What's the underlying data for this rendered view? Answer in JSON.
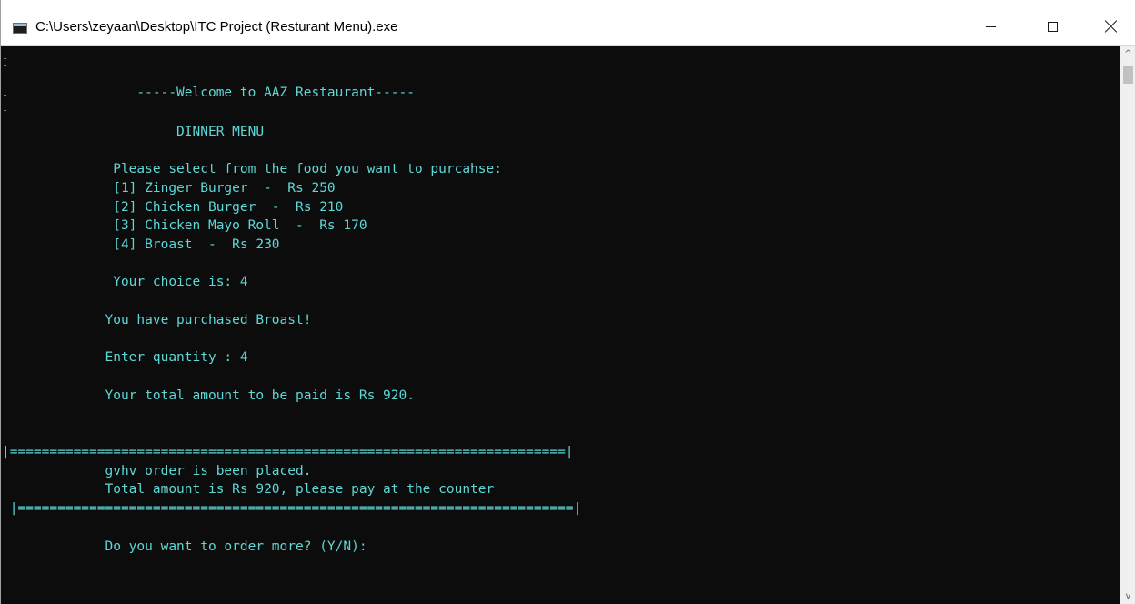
{
  "window": {
    "title": "C:\\Users\\zeyaan\\Desktop\\ITC Project (Resturant Menu).exe",
    "controls": {
      "minimize": "minimize-icon",
      "maximize": "maximize-icon",
      "close": "close-icon"
    }
  },
  "console": {
    "text_color": "#5fd7d7",
    "background": "#0c0c0c",
    "lines": {
      "welcome": "                 -----Welcome to AAZ Restaurant-----",
      "menu_title": "                      DINNER MENU",
      "prompt": "              Please select from the food you want to purcahse:",
      "item1": "              [1] Zinger Burger  -  Rs 250",
      "item2": "              [2] Chicken Burger  -  Rs 210",
      "item3": "              [3] Chicken Mayo Roll  -  Rs 170",
      "item4": "              [4] Broast  -  Rs 230",
      "choice": "              Your choice is: 4",
      "purchased": "             You have purchased Broast!",
      "quantity": "             Enter quantity : 4",
      "total": "             Your total amount to be paid is Rs 920.",
      "border_top": "|======================================================================|",
      "order_placed": "             gvhv order is been placed.",
      "counter": "             Total amount is Rs 920, please pay at the counter",
      "border_bottom": " |======================================================================|",
      "more": "             Do you want to order more? (Y/N):"
    }
  },
  "scrollbar": {
    "up_arrow": "^",
    "down_arrow": "v"
  }
}
